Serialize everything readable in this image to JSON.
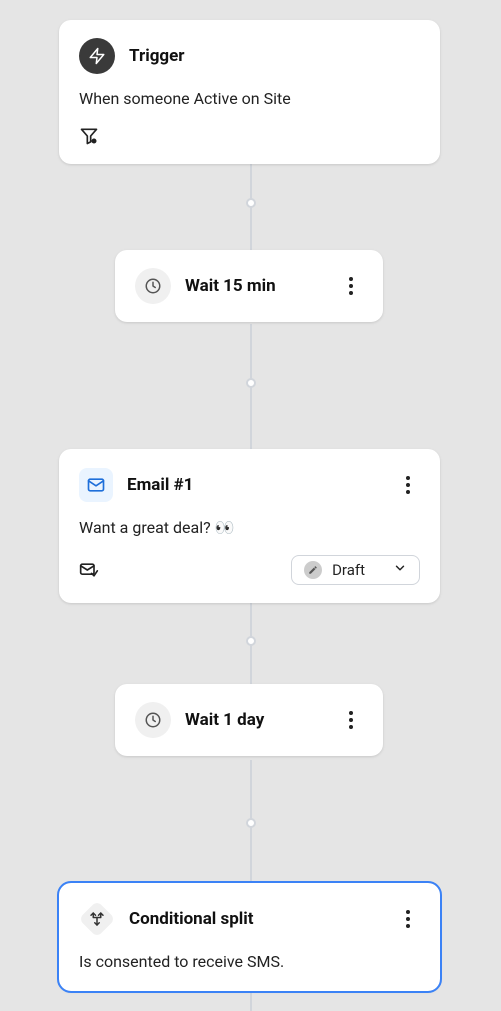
{
  "trigger": {
    "title": "Trigger",
    "description": "When someone Active on Site"
  },
  "wait1": {
    "label": "Wait 15 min"
  },
  "email1": {
    "title": "Email #1",
    "subject": "Want a great deal? 👀",
    "status": "Draft"
  },
  "wait2": {
    "label": "Wait 1 day"
  },
  "split": {
    "title": "Conditional split",
    "description": "Is consented to receive SMS."
  }
}
